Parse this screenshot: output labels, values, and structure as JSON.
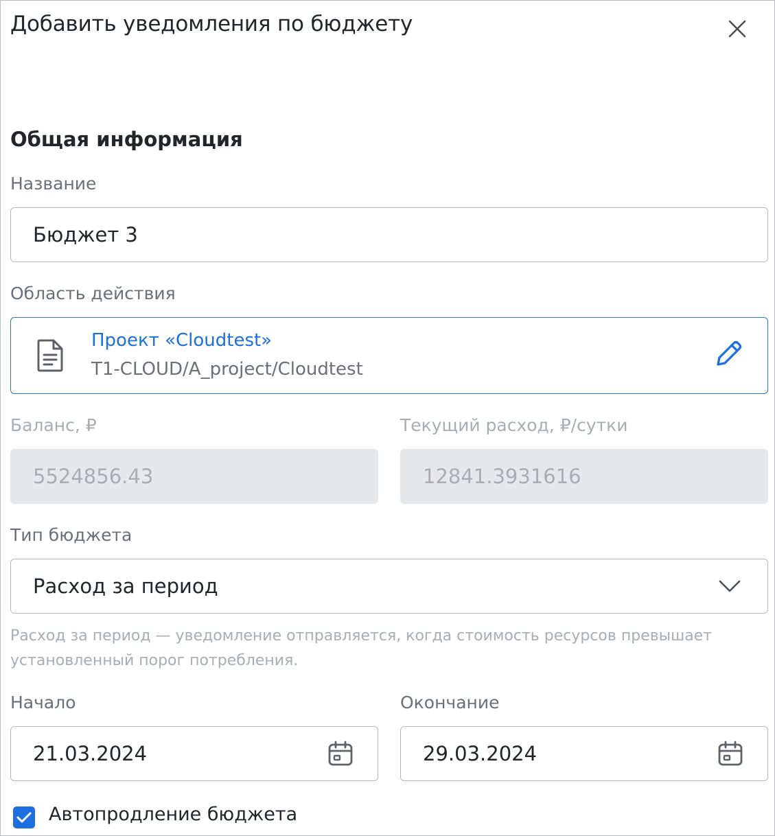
{
  "dialog": {
    "title": "Добавить уведомления по бюджету",
    "close_icon": "close-icon"
  },
  "general": {
    "section_title": "Общая информация",
    "name_label": "Название",
    "name_value": "Бюджет 3",
    "scope_label": "Область действия",
    "scope_title": "Проект «Cloudtest»",
    "scope_path": "T1-CLOUD/A_project/Cloudtest",
    "scope_icon": "document-icon",
    "edit_icon": "pencil-icon",
    "balance_label": "Баланс, ₽",
    "balance_value": "5524856.43",
    "expense_label": "Текущий расход, ₽/сутки",
    "expense_value": "12841.3931616",
    "budget_type_label": "Тип бюджета",
    "budget_type_value": "Расход за период",
    "budget_type_hint": "Расход за период — уведомление отправляется, когда стоимость ресурсов превышает установленный порог потребления.",
    "start_label": "Начало",
    "start_value": "21.03.2024",
    "end_label": "Окончание",
    "end_value": "29.03.2024",
    "autorenew_label": "Автопродление бюджета",
    "autorenew_checked": true
  },
  "colors": {
    "accent": "#1d6fe0",
    "text": "#22262b",
    "muted": "#6b7078",
    "disabled_bg": "#e7e8eb"
  }
}
